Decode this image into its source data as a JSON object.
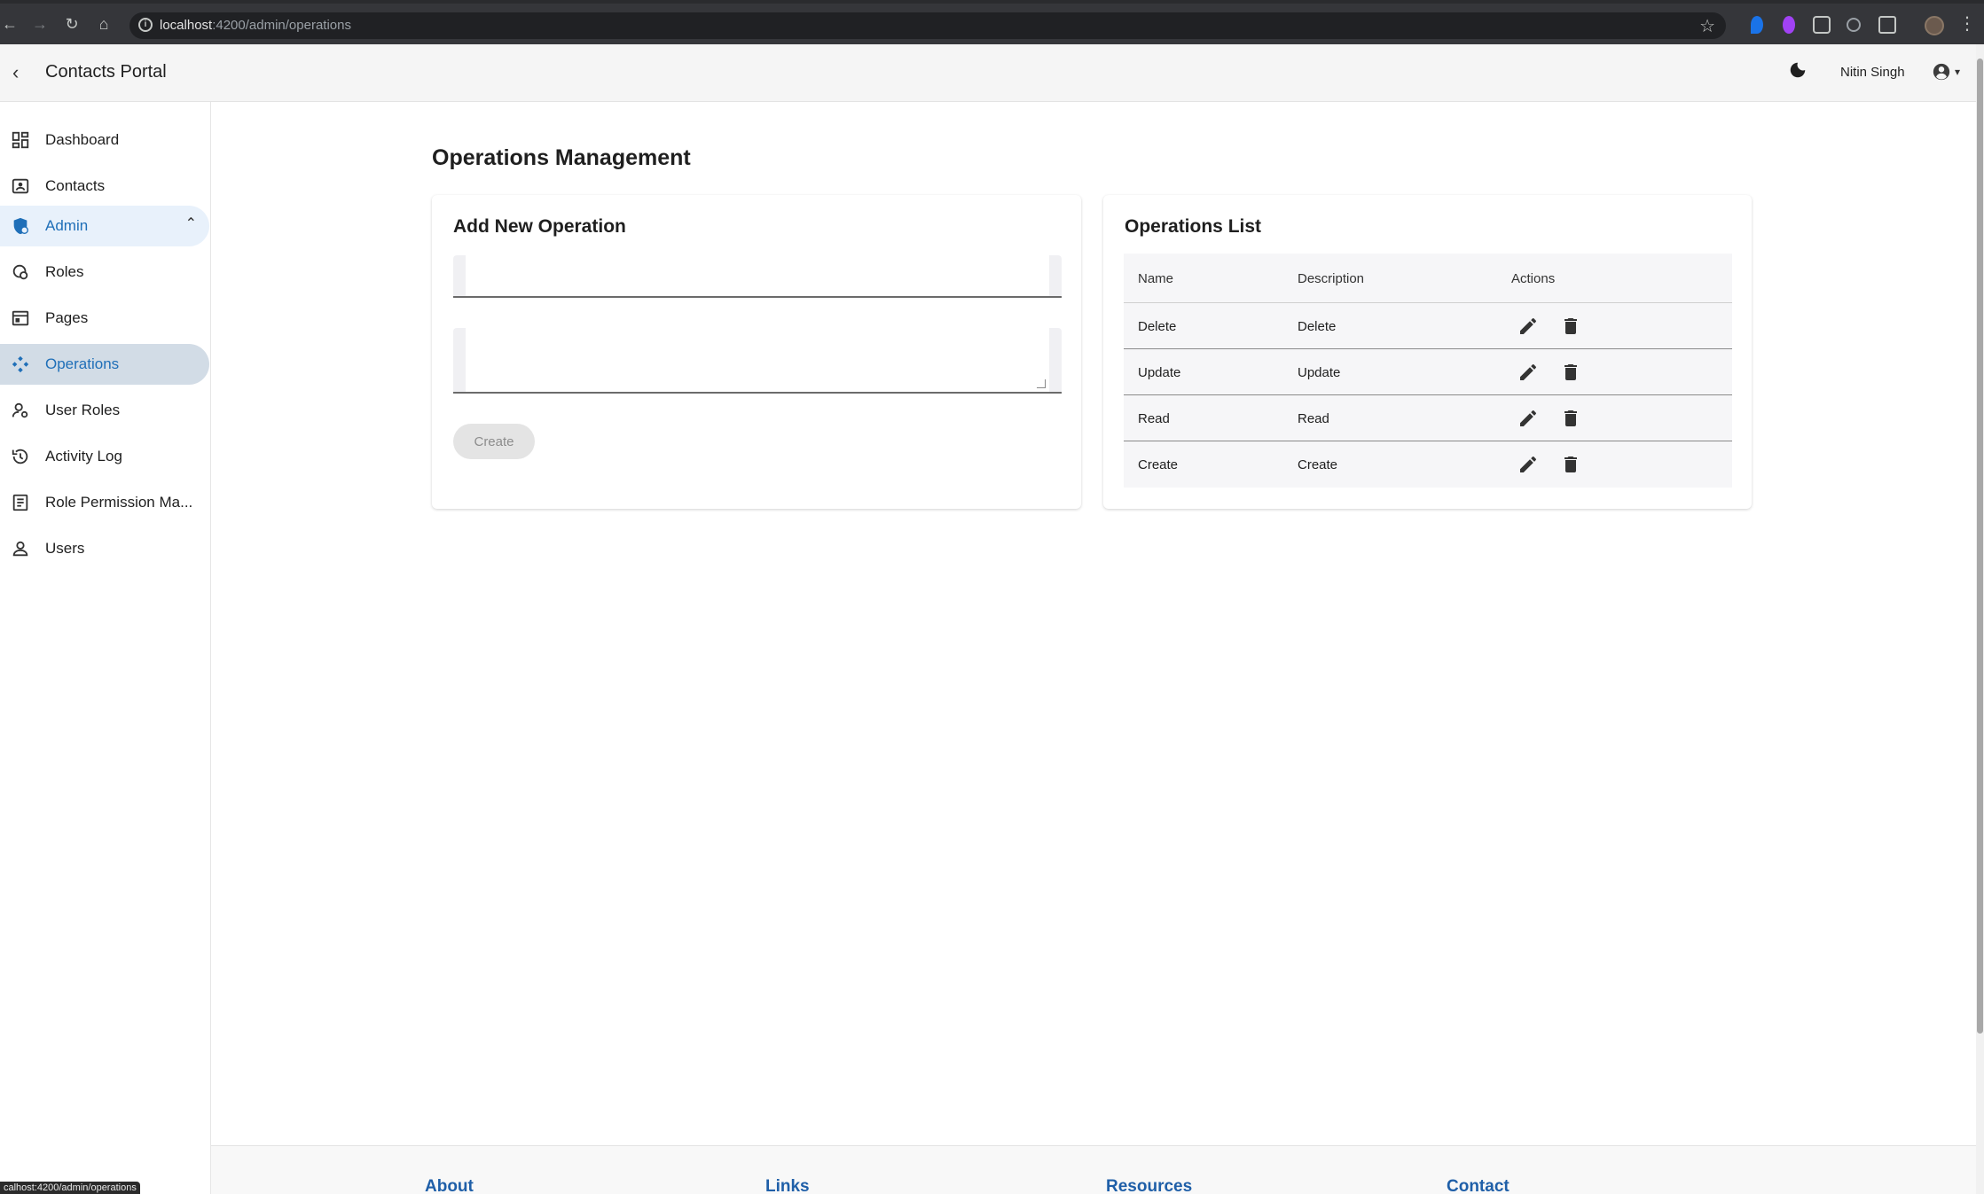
{
  "browser": {
    "url_host": "localhost",
    "url_rest": ":4200/admin/operations"
  },
  "header": {
    "title": "Contacts Portal",
    "user_name": "Nitin Singh"
  },
  "sidebar": {
    "items": [
      {
        "label": "Dashboard",
        "icon": "dashboard-icon"
      },
      {
        "label": "Contacts",
        "icon": "contacts-icon"
      },
      {
        "label": "Admin",
        "icon": "admin-icon"
      },
      {
        "label": "Roles",
        "icon": "roles-icon"
      },
      {
        "label": "Pages",
        "icon": "pages-icon"
      },
      {
        "label": "Operations",
        "icon": "operations-icon"
      },
      {
        "label": "User Roles",
        "icon": "user-roles-icon"
      },
      {
        "label": "Activity Log",
        "icon": "history-icon"
      },
      {
        "label": "Role Permission Ma...",
        "icon": "list-icon"
      },
      {
        "label": "Users",
        "icon": "person-icon"
      }
    ]
  },
  "main": {
    "page_title": "Operations Management",
    "add_card": {
      "title": "Add New Operation",
      "create_label": "Create"
    },
    "list_card": {
      "title": "Operations List",
      "columns": [
        "Name",
        "Description",
        "Actions"
      ],
      "rows": [
        {
          "name": "Delete",
          "description": "Delete"
        },
        {
          "name": "Update",
          "description": "Update"
        },
        {
          "name": "Read",
          "description": "Read"
        },
        {
          "name": "Create",
          "description": "Create"
        }
      ]
    }
  },
  "footer": {
    "headings": [
      "About",
      "Links",
      "Resources",
      "Contact"
    ]
  },
  "status_bar": {
    "url": "calhost:4200/admin/operations"
  },
  "colors": {
    "accent": "#1f6fb8",
    "active_bg": "#d2dce6",
    "admin_bg": "#e8f1fb",
    "footer_heading": "#1f5fa8"
  }
}
